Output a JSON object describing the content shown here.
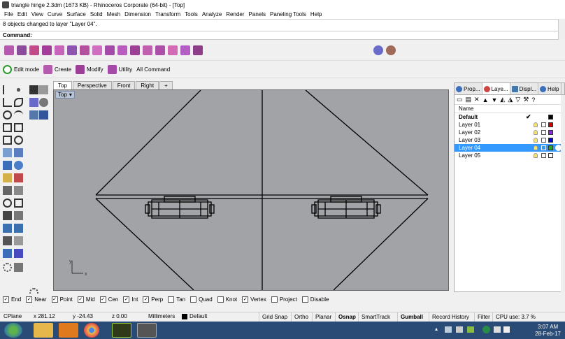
{
  "window": {
    "title": "triangle hinge 2.3dm (1673 KB) - Rhinoceros Corporate (64-bit) - [Top]"
  },
  "menu": [
    "File",
    "Edit",
    "View",
    "Curve",
    "Surface",
    "Solid",
    "Mesh",
    "Dimension",
    "Transform",
    "Tools",
    "Analyze",
    "Render",
    "Panels",
    "Paneling Tools",
    "Help"
  ],
  "history_text": "8 objects changed to layer \"Layer 04\".",
  "command_label": "Command:",
  "toolbar2": {
    "edit_mode": "Edit mode",
    "create": "Create",
    "modify": "Modify",
    "utility": "Utility",
    "all_command": "All Command"
  },
  "view_tabs": [
    "Top",
    "Perspective",
    "Front",
    "Right",
    "+"
  ],
  "viewport_label": "Top",
  "panel_tabs": [
    "Prop...",
    "Laye...",
    "Displ...",
    "Help"
  ],
  "layers": {
    "header": "Name",
    "rows": [
      {
        "name": "Default",
        "bold": true,
        "current": true,
        "color": "#000000"
      },
      {
        "name": "Layer 01",
        "color": "#cc0000"
      },
      {
        "name": "Layer 02",
        "color": "#8a2be2"
      },
      {
        "name": "Layer 03",
        "color": "#0000cc"
      },
      {
        "name": "Layer 04",
        "color": "#22aa22",
        "selected": true
      },
      {
        "name": "Layer 05",
        "color": "#ffffff"
      }
    ]
  },
  "osnap": [
    {
      "label": "End",
      "checked": true
    },
    {
      "label": "Near",
      "checked": true
    },
    {
      "label": "Point",
      "checked": true
    },
    {
      "label": "Mid",
      "checked": true
    },
    {
      "label": "Cen",
      "checked": true
    },
    {
      "label": "Int",
      "checked": true
    },
    {
      "label": "Perp",
      "checked": true
    },
    {
      "label": "Tan",
      "checked": false
    },
    {
      "label": "Quad",
      "checked": false
    },
    {
      "label": "Knot",
      "checked": false
    },
    {
      "label": "Vertex",
      "checked": true
    },
    {
      "label": "Project",
      "checked": false
    },
    {
      "label": "Disable",
      "checked": false
    }
  ],
  "status": {
    "cplane": "CPlane",
    "x": "x 281.12",
    "y": "y -24.43",
    "z": "z 0.00",
    "units": "Millimeters",
    "layer": "Default",
    "grid_snap": "Grid Snap",
    "ortho": "Ortho",
    "planar": "Planar",
    "osnap": "Osnap",
    "smarttrack": "SmartTrack",
    "gumball": "Gumball",
    "record_history": "Record History",
    "filter": "Filter",
    "cpu": "CPU use: 3.7 %"
  },
  "clock": {
    "time": "3:07 AM",
    "date": "28-Feb-17"
  }
}
